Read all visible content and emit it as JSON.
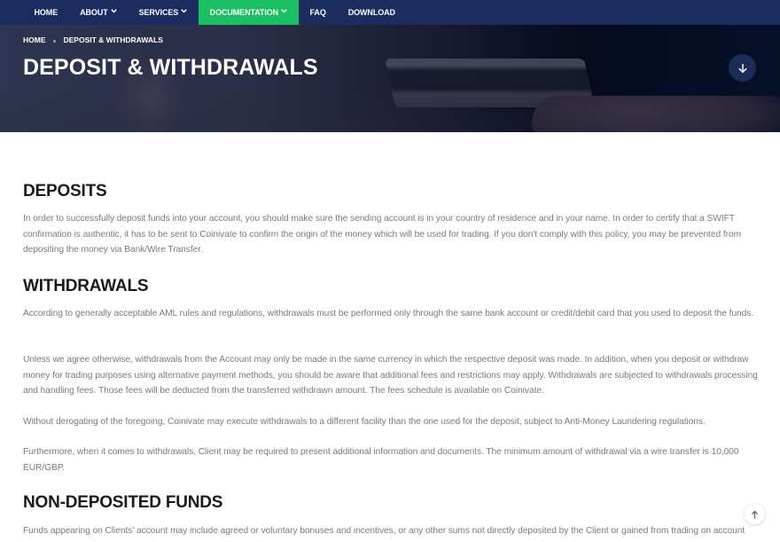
{
  "nav": {
    "items": [
      {
        "label": "HOME",
        "has_dropdown": false,
        "active": false
      },
      {
        "label": "ABOUT",
        "has_dropdown": true,
        "active": false
      },
      {
        "label": "SERVICES",
        "has_dropdown": true,
        "active": false
      },
      {
        "label": "DOCUMENTATION",
        "has_dropdown": true,
        "active": true
      },
      {
        "label": "FAQ",
        "has_dropdown": false,
        "active": false
      },
      {
        "label": "DOWNLOAD",
        "has_dropdown": false,
        "active": false
      }
    ],
    "chevron_glyph": "❯"
  },
  "hero": {
    "breadcrumb": {
      "home": "HOME",
      "current": "DEPOSIT & WITHDRAWALS"
    },
    "title": "DEPOSIT & WITHDRAWALS",
    "scroll_down_icon": "arrow-down-icon"
  },
  "sections": {
    "deposits": {
      "title": "DEPOSITS",
      "paragraphs": [
        "In order to successfully deposit funds into your account, you should make sure the sending account is in your country of residence and in your name. In order to certify that a SWIFT confirmation is authentic, it has to be sent to Coinivate to confirm the origin of the money which will be used for trading. If you don't comply with this policy, you may be prevented from depositing the money via Bank/Wire Transfer."
      ]
    },
    "withdrawals": {
      "title": "WITHDRAWALS",
      "paragraphs": [
        "According to generally acceptable AML rules and regulations, withdrawals must be performed only through the same bank account or credit/debit card that you used to deposit the funds.",
        "Unless we agree otherwise, withdrawals from the Account may only be made in the same currency in which the respective deposit was made. In addition, when you deposit or withdraw money for trading purposes using alternative payment methods, you should be aware that additional fees and restrictions may apply. Withdrawals are subjected to withdrawals processing and handling fees. Those fees will be deducted from the transferred withdrawn amount. The fees schedule is available on Coinivate.",
        "Without derogating of the foregoing, Coinivate may execute withdrawals to a different facility than the one used for the deposit, subject to Anti-Money Laundering regulations.",
        "Furthermore, when it comes to withdrawals, Client may be required to present additional information and documents. The minimum amount of withdrawal via a wire transfer is 10,000 EUR/GBP."
      ]
    },
    "non_deposited": {
      "title": "NON-DEPOSITED FUNDS",
      "paragraphs": [
        "Funds appearing on Clients' account may include agreed or voluntary bonuses and incentives, or any other sums not directly deposited by the Client or gained from trading on account"
      ]
    }
  },
  "back_to_top_icon": "arrow-up-icon",
  "colors": {
    "nav_bg": "#1b2c5e",
    "nav_active": "#1bbf63",
    "heading": "#1a1a1a",
    "body_text": "#7a7a7a"
  }
}
